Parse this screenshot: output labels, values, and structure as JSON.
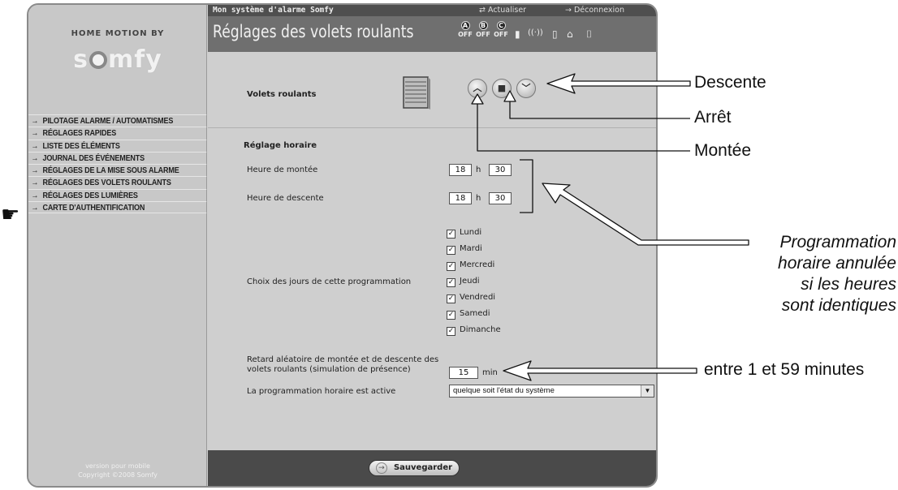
{
  "brand": {
    "tagline": "HOME MOTION BY",
    "logo": "somfy"
  },
  "sidebar": {
    "items": [
      {
        "label": "PILOTAGE ALARME / AUTOMATISMES"
      },
      {
        "label": "RÉGLAGES RAPIDES"
      },
      {
        "label": "LISTE DES ÉLÉMENTS"
      },
      {
        "label": "JOURNAL DES ÉVÉNEMENTS"
      },
      {
        "label": "RÉGLAGES DE LA MISE SOUS ALARME"
      },
      {
        "label": "RÉGLAGES DES VOLETS ROULANTS"
      },
      {
        "label": "RÉGLAGES DES LUMIÈRES"
      },
      {
        "label": "CARTE D'AUTHENTIFICATION"
      }
    ],
    "footer_line1": "version pour mobile",
    "footer_line2": "Copyright ©2008 Somfy"
  },
  "header": {
    "system_title": "Mon système d'alarme Somfy",
    "refresh_label": "Actualiser",
    "logout_label": "Déconnexion",
    "page_title": "Réglages des volets roulants",
    "zones": [
      {
        "letter": "A",
        "state": "OFF"
      },
      {
        "letter": "B",
        "state": "OFF"
      },
      {
        "letter": "C",
        "state": "OFF"
      }
    ],
    "status_icons": [
      "battery-icon",
      "radio-signal-icon",
      "door-icon",
      "house-icon",
      "window-icon"
    ]
  },
  "shutters": {
    "label": "Volets roulants",
    "up_symbol": "︿",
    "stop_symbol": "■",
    "down_symbol": "﹀"
  },
  "schedule": {
    "section_title": "Réglage horaire",
    "up_time_label": "Heure de montée",
    "up_hour": "18",
    "up_minute": "30",
    "down_time_label": "Heure de descente",
    "down_hour": "18",
    "down_minute": "30",
    "hour_unit": "h",
    "days_label": "Choix des jours de cette programmation",
    "days": [
      {
        "name": "Lundi",
        "checked": true
      },
      {
        "name": "Mardi",
        "checked": true
      },
      {
        "name": "Mercredi",
        "checked": true
      },
      {
        "name": "Jeudi",
        "checked": true
      },
      {
        "name": "Vendredi",
        "checked": true
      },
      {
        "name": "Samedi",
        "checked": true
      },
      {
        "name": "Dimanche",
        "checked": true
      }
    ],
    "random_delay_label": "Retard aléatoire de montée et de descente des volets roulants (simulation de présence)",
    "random_delay_value": "15",
    "random_delay_unit": "min",
    "active_label": "La programmation horaire est active",
    "active_option": "quelque soit l'état du système"
  },
  "footer": {
    "save_label": "Sauvegarder"
  },
  "annotations": {
    "descente": "Descente",
    "arret": "Arrêt",
    "montee": "Montée",
    "prog_line1": "Programmation",
    "prog_line2": "horaire annulée",
    "prog_line3": "si les heures",
    "prog_line4": "sont identiques",
    "minutes": "entre 1 et 59 minutes"
  }
}
